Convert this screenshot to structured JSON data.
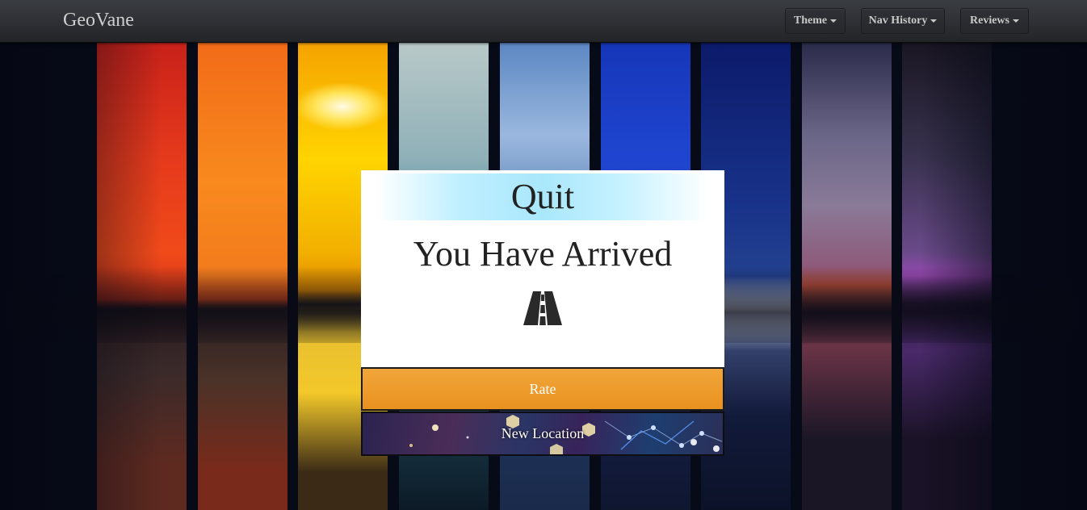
{
  "navbar": {
    "brand": "GeoVane",
    "menus": [
      {
        "label": "Theme"
      },
      {
        "label": "Nav History"
      },
      {
        "label": "Reviews"
      }
    ]
  },
  "modal": {
    "title": "Quit",
    "message": "You Have Arrived",
    "icon": "road-icon"
  },
  "buttons": {
    "rate": "Rate",
    "new_location": "New Location"
  },
  "colors": {
    "accent_orange": "#e8921f",
    "banner_cyan": "#a9e7fb",
    "navbar": "#2b2d31"
  }
}
